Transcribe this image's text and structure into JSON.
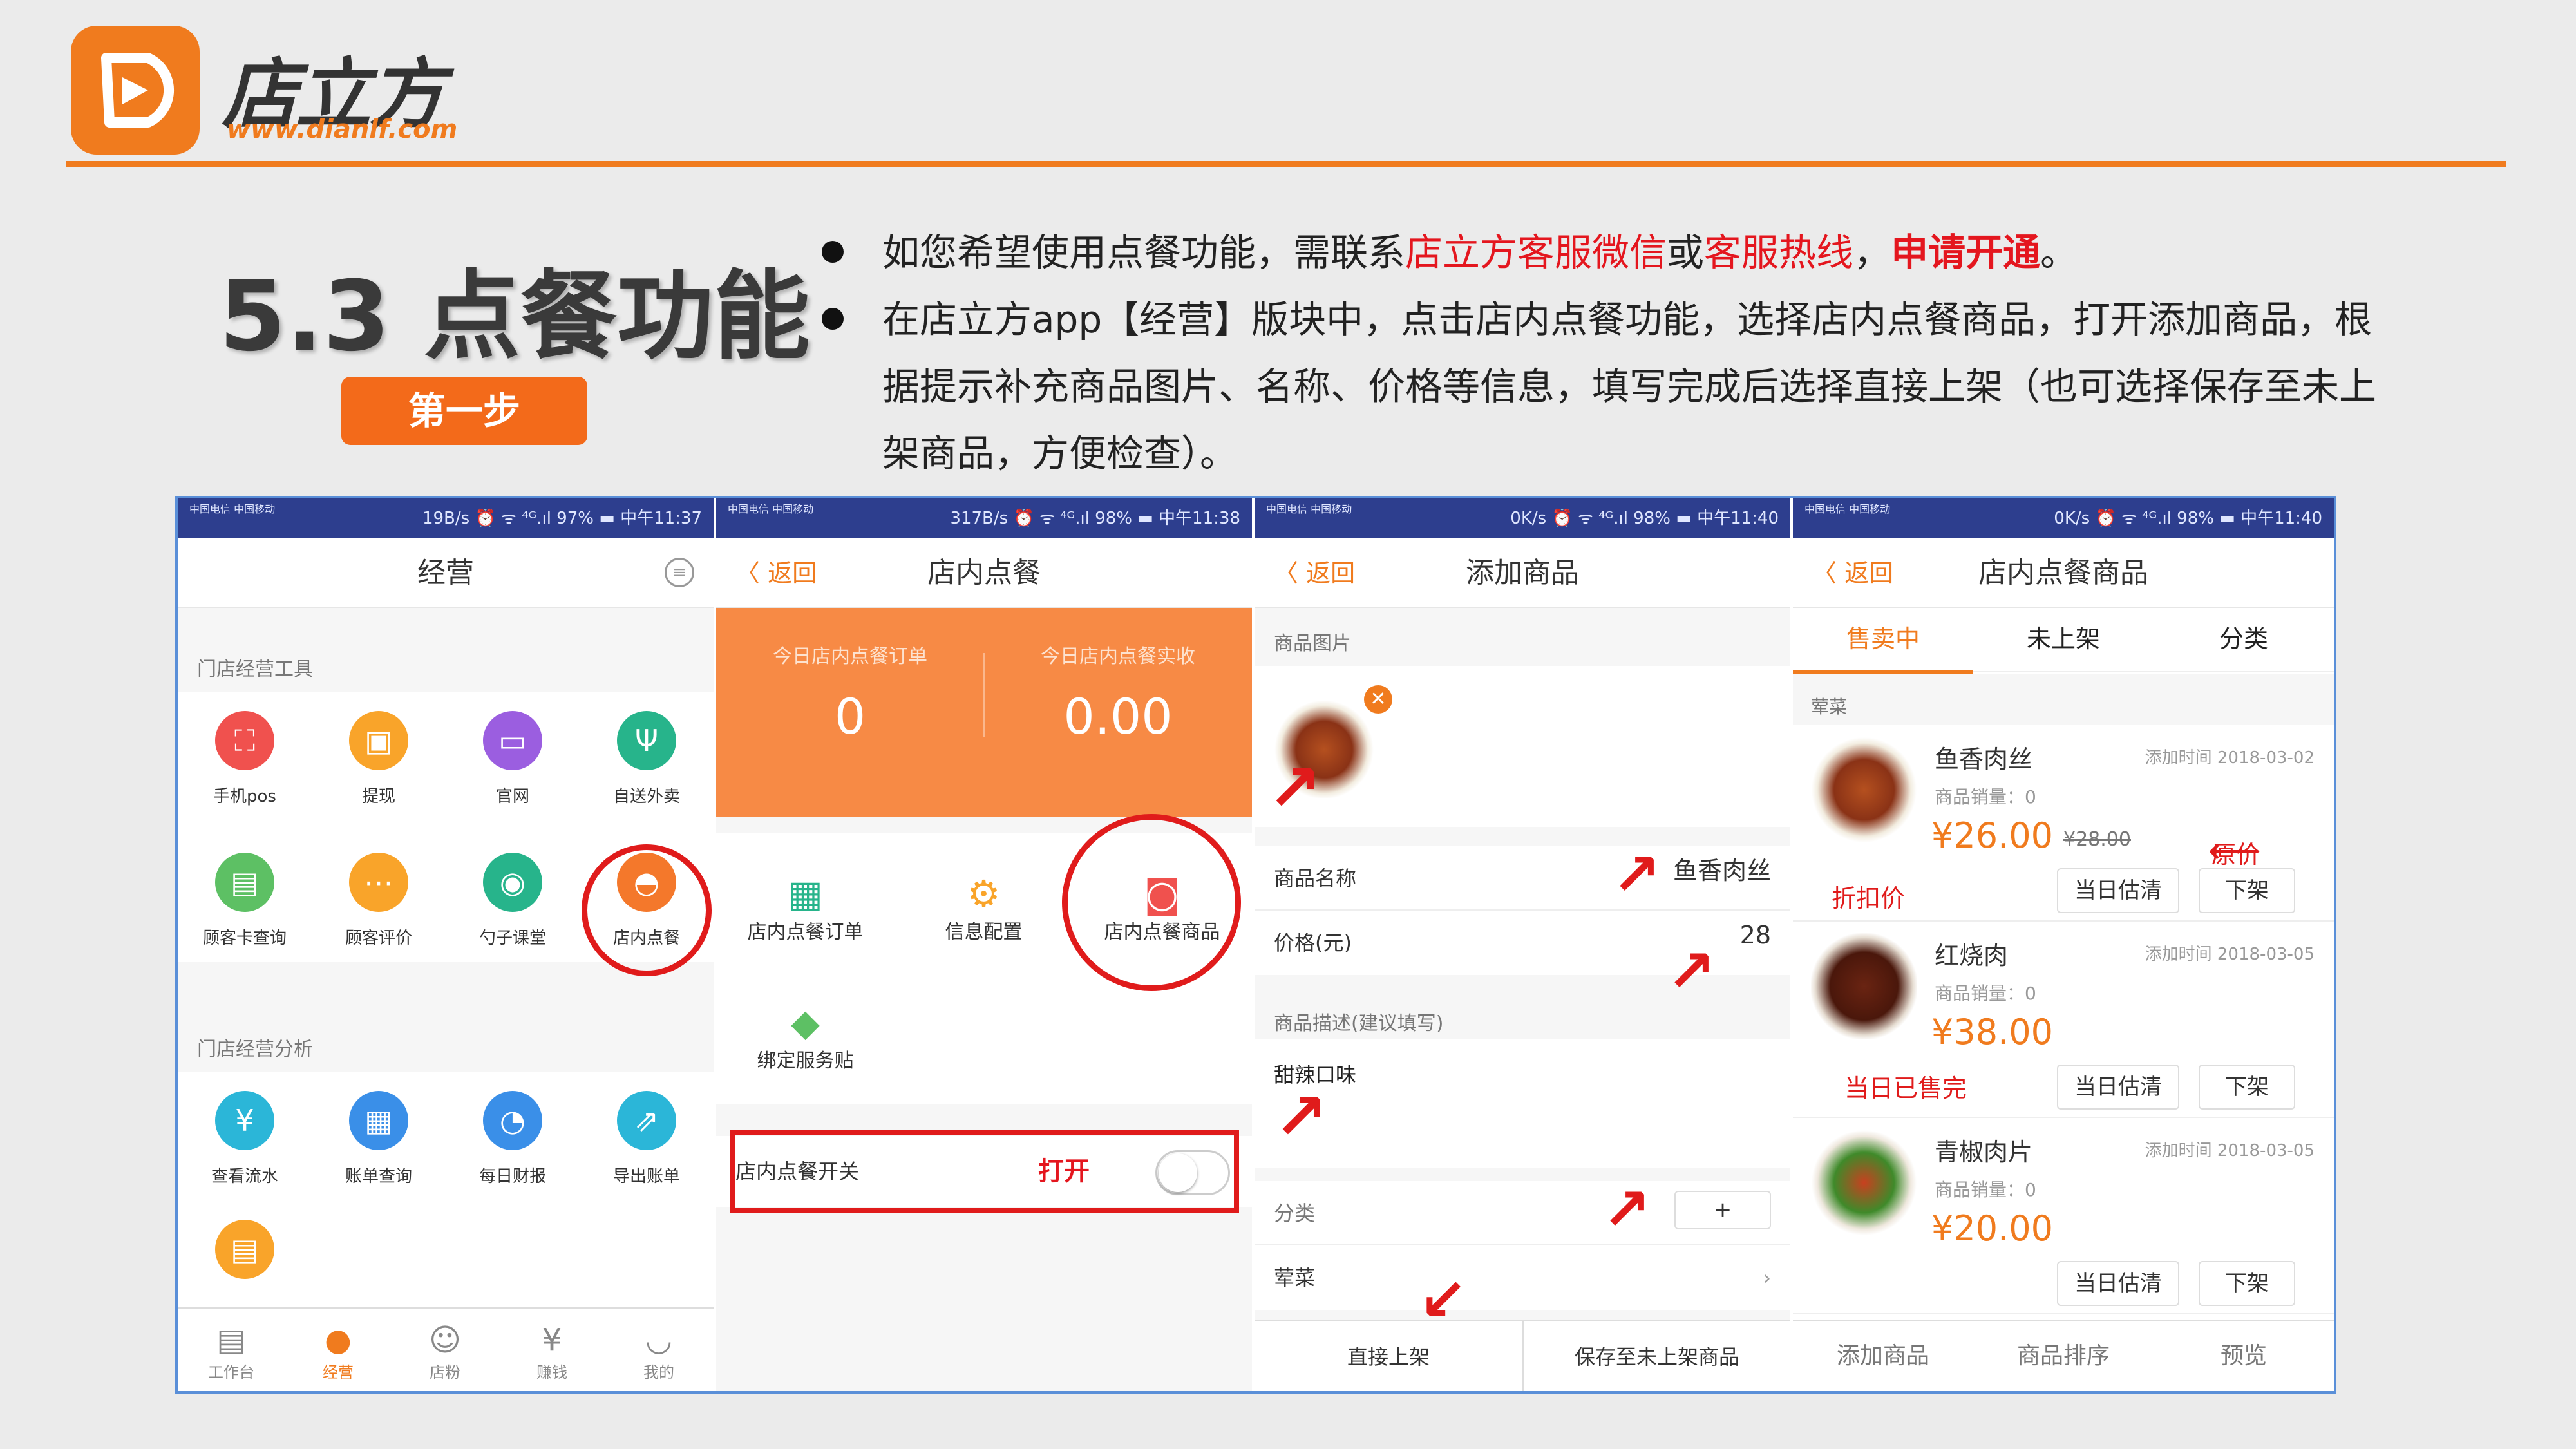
{
  "brand": {
    "name": "店立方",
    "url": "www.dianlf.com",
    "accent": "#f07b1e"
  },
  "slide": {
    "title": "5.3 点餐功能",
    "step_label": "第一步",
    "bullet1": {
      "a": "如您希望使用点餐功能，需联系",
      "b": "店立方客服微信",
      "c": "或",
      "d": "客服热线",
      "e": "，",
      "f": "申请开通",
      "g": "。"
    },
    "bullet2": "在店立方app【经营】版块中，点击店内点餐功能，选择店内点餐商品，打开添加商品，根据提示补充商品图片、名称、价格等信息，填写完成后选择直接上架（也可选择保存至未上架商品，方便检查）。"
  },
  "screen1": {
    "status": {
      "carrier": "中国电信\n中国移动",
      "right": "19B/s ⏰ ᯤ ⁴ᴳ.ıl 97% ▬ 中午11:37"
    },
    "title": "经营",
    "section_tools": "门店经营工具",
    "tools": [
      "手机pos",
      "提现",
      "官网",
      "自送外卖",
      "顾客卡查询",
      "顾客评价",
      "勺子课堂",
      "店内点餐"
    ],
    "section_analysis": "门店经营分析",
    "analysis": [
      "查看流水",
      "账单查询",
      "每日财报",
      "导出账单"
    ],
    "tabs": [
      "工作台",
      "经营",
      "店粉",
      "赚钱",
      "我的"
    ]
  },
  "screen2": {
    "status": {
      "right": "317B/s ⏰ ᯤ ⁴ᴳ.ıl 98% ▬ 中午11:38"
    },
    "back": "返回",
    "title": "店内点餐",
    "stat1_label": "今日店内点餐订单",
    "stat1_value": "0",
    "stat2_label": "今日店内点餐实收",
    "stat2_value": "0.00",
    "menu": [
      "店内点餐订单",
      "信息配置",
      "店内点餐商品",
      "绑定服务贴"
    ],
    "switch_label": "店内点餐开关",
    "switch_note": "打开"
  },
  "screen3": {
    "status": {
      "right": "0K/s ⏰ ᯤ ⁴ᴳ.ıl 98% ▬ 中午11:40"
    },
    "back": "返回",
    "title": "添加商品",
    "img_label": "商品图片",
    "name_label": "商品名称",
    "name_value": "鱼香肉丝",
    "price_label": "价格(元)",
    "price_value": "28",
    "desc_label": "商品描述(建议填写)",
    "desc_value": "甜辣口味",
    "cat_label": "分类",
    "cat_add": "+",
    "cat_value": "荤菜",
    "btn_publish": "直接上架",
    "btn_save": "保存至未上架商品"
  },
  "screen4": {
    "status": {
      "right": "0K/s ⏰ ᯤ ⁴ᴳ.ıl 98% ▬ 中午11:40"
    },
    "back": "返回",
    "title": "店内点餐商品",
    "tabs": [
      "售卖中",
      "未上架",
      "分类"
    ],
    "group": "荤菜",
    "products": [
      {
        "name": "鱼香肉丝",
        "date": "添加时间  2018-03-02",
        "sold": "商品销量：0",
        "price": "¥26.00",
        "orig": "¥28.00"
      },
      {
        "name": "红烧肉",
        "date": "添加时间  2018-03-05",
        "sold": "商品销量：0",
        "price": "¥38.00"
      },
      {
        "name": "青椒肉片",
        "date": "添加时间  2018-03-05",
        "sold": "商品销量：0",
        "price": "¥20.00"
      }
    ],
    "btn_estimate": "当日估清",
    "btn_off": "下架",
    "annotations": {
      "orig": "原价",
      "discount": "折扣价",
      "soldout": "当日已售完"
    },
    "bottom": [
      "添加商品",
      "商品排序",
      "预览"
    ]
  }
}
